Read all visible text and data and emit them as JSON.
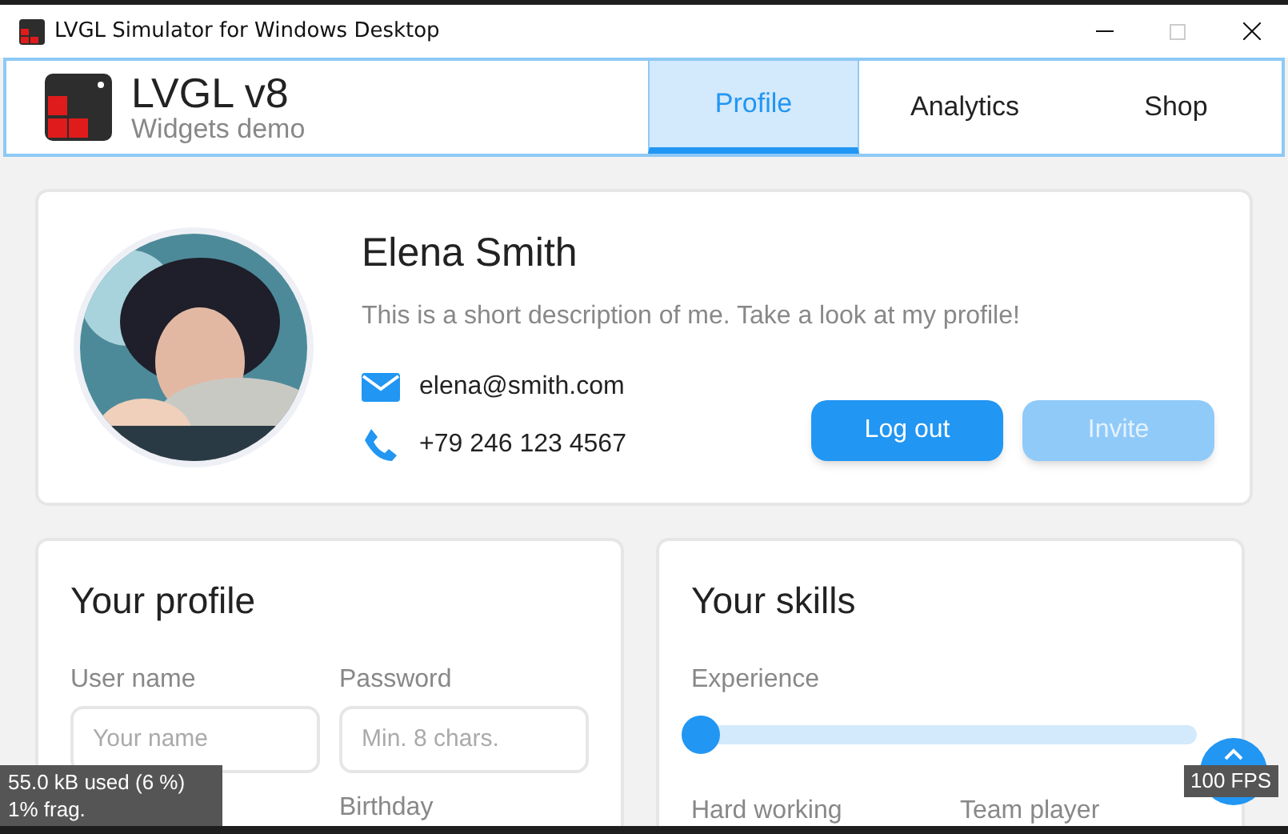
{
  "window": {
    "title": "LVGL Simulator for Windows Desktop"
  },
  "header": {
    "title": "LVGL v8",
    "subtitle": "Widgets demo"
  },
  "tabs": [
    {
      "label": "Profile",
      "selected": true
    },
    {
      "label": "Analytics",
      "selected": false
    },
    {
      "label": "Shop",
      "selected": false
    }
  ],
  "profile": {
    "name": "Elena Smith",
    "description": "This is a short description of me. Take a look at my profile!",
    "email": "elena@smith.com",
    "phone": "+79 246 123 4567",
    "buttons": [
      {
        "label": "Log out",
        "disabled": false
      },
      {
        "label": "Invite",
        "disabled": true
      }
    ]
  },
  "your_profile": {
    "title": "Your profile",
    "fields": [
      {
        "label": "User name",
        "placeholder": "Your name"
      },
      {
        "label": "Password",
        "placeholder": "Min. 8 chars."
      }
    ],
    "labels": [
      "Birthday"
    ]
  },
  "your_skills": {
    "title": "Your skills",
    "experience": {
      "label": "Experience",
      "level": 0
    },
    "labels": [
      "Hard working",
      "Team player"
    ]
  },
  "overlay": {
    "memory": "55.0 kB used (6 %)",
    "fragmentation": "1% frag.",
    "fps": "100 FPS"
  }
}
